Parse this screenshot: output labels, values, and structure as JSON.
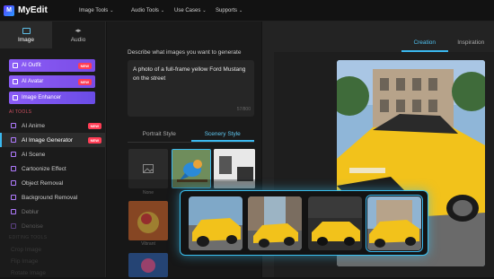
{
  "app": {
    "name": "MyEdit",
    "logo_letter": "M"
  },
  "nav": [
    {
      "label": "Image Tools"
    },
    {
      "label": "Audio Tools"
    },
    {
      "label": "Use Cases"
    },
    {
      "label": "Supports"
    }
  ],
  "modes": [
    {
      "label": "Image",
      "active": true
    },
    {
      "label": "Audio",
      "active": false
    }
  ],
  "promos": [
    {
      "label": "AI Outfit",
      "badge": "NEW"
    },
    {
      "label": "AI Avatar",
      "badge": "NEW"
    },
    {
      "label": "Image Enhancer",
      "badge": ""
    }
  ],
  "section_label": "AI TOOLS",
  "tools": [
    {
      "label": "AI Anime",
      "badge": "NEW"
    },
    {
      "label": "AI Image Generator",
      "badge": "NEW",
      "active": true
    },
    {
      "label": "AI Scene",
      "badge": ""
    },
    {
      "label": "Cartoonize Effect",
      "badge": ""
    },
    {
      "label": "Object Removal",
      "badge": ""
    },
    {
      "label": "Background Removal",
      "badge": ""
    },
    {
      "label": "Deblur",
      "badge": ""
    },
    {
      "label": "Denoise",
      "badge": ""
    }
  ],
  "faded_items": [
    {
      "label": "EDITING TOOLS"
    },
    {
      "label": "Crop Image"
    },
    {
      "label": "Flip Image"
    },
    {
      "label": "Rotate Image"
    }
  ],
  "generator": {
    "desc_label": "Describe what images you want to generate",
    "prompt": "A photo of a full-frame yellow Ford Mustang on the street",
    "counter": "57/800",
    "style_tabs": [
      {
        "label": "Portrait Style",
        "active": false
      },
      {
        "label": "Scenery Style",
        "active": true
      }
    ],
    "none_label": "None",
    "vibrant_label": "Vibrant"
  },
  "result_tabs": [
    {
      "label": "Creation",
      "active": true
    },
    {
      "label": "Inspiration",
      "active": false
    }
  ],
  "colors": {
    "accent": "#3ab8ef",
    "promo": "#8b5cf6",
    "badge": "#ff3d55",
    "car": "#f2c21b"
  },
  "icons": [
    "image-mode-icon",
    "audio-mode-icon",
    "none-style-icon"
  ]
}
